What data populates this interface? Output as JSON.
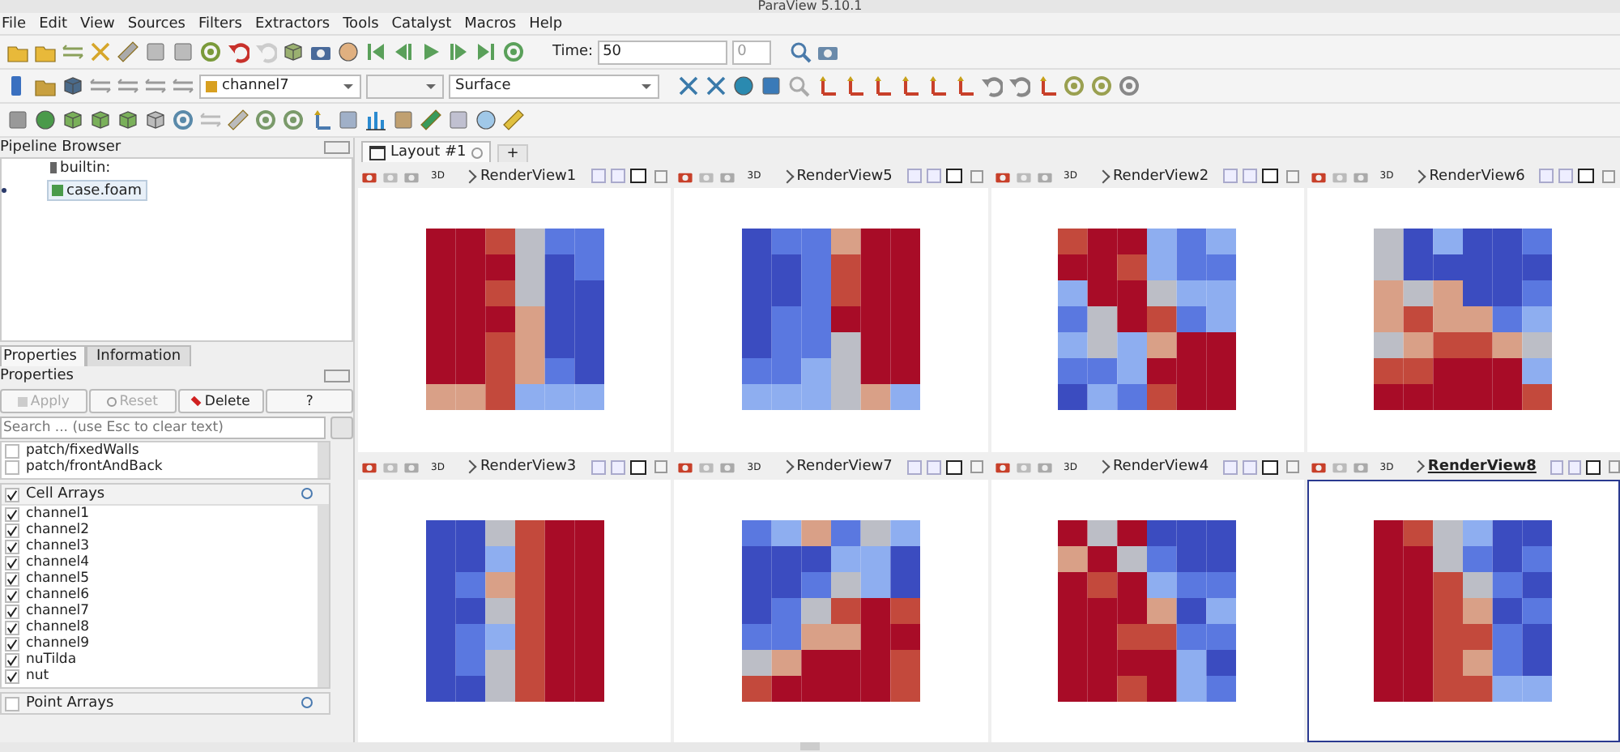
{
  "window": {
    "title": "ParaView 5.10.1"
  },
  "menu": [
    "File",
    "Edit",
    "View",
    "Sources",
    "Filters",
    "Extractors",
    "Tools",
    "Catalyst",
    "Macros",
    "Help"
  ],
  "toolbar": {
    "time_label": "Time:",
    "time_value": "50",
    "time_index": "0",
    "active_array": "channel7",
    "representation": "Surface"
  },
  "pipeline_browser": {
    "title": "Pipeline Browser",
    "items": [
      {
        "label": "builtin:",
        "selected": false,
        "children": [
          {
            "label": "case.foam",
            "selected": true,
            "visible": true
          }
        ]
      }
    ]
  },
  "panel_tabs": [
    {
      "label": "Properties",
      "selected": true
    },
    {
      "label": "Information",
      "selected": false
    }
  ],
  "properties": {
    "title": "Properties",
    "buttons": [
      {
        "label": "Apply",
        "kind": "apply",
        "disabled": true
      },
      {
        "label": "Reset",
        "kind": "reset",
        "disabled": true
      },
      {
        "label": "Delete",
        "kind": "delete",
        "disabled": false
      },
      {
        "label": "?",
        "kind": "help",
        "disabled": false
      }
    ],
    "search": {
      "placeholder": "Search ... (use Esc to clear text)"
    },
    "patches": [
      {
        "label": "patch/fixedWalls",
        "checked": false
      },
      {
        "label": "patch/frontAndBack",
        "checked": false
      }
    ],
    "cell_arrays": {
      "label": "Cell Arrays",
      "checked": true,
      "items": [
        {
          "label": "channel1",
          "checked": true
        },
        {
          "label": "channel2",
          "checked": true
        },
        {
          "label": "channel3",
          "checked": true
        },
        {
          "label": "channel4",
          "checked": true
        },
        {
          "label": "channel5",
          "checked": true
        },
        {
          "label": "channel6",
          "checked": true
        },
        {
          "label": "channel7",
          "checked": true
        },
        {
          "label": "channel8",
          "checked": true
        },
        {
          "label": "channel9",
          "checked": true
        },
        {
          "label": "nuTilda",
          "checked": true
        },
        {
          "label": "nut",
          "checked": true
        }
      ]
    },
    "point_arrays": {
      "label": "Point Arrays",
      "checked": false
    }
  },
  "layout_tabs": [
    {
      "label": "Layout #1",
      "selected": true
    }
  ],
  "add_tab": "+",
  "views": [
    {
      "title": "RenderView1",
      "mode": "3D",
      "active": false
    },
    {
      "title": "RenderView5",
      "mode": "3D",
      "active": false
    },
    {
      "title": "RenderView2",
      "mode": "3D",
      "active": false
    },
    {
      "title": "RenderView6",
      "mode": "3D",
      "active": false
    },
    {
      "title": "RenderView3",
      "mode": "3D",
      "active": false
    },
    {
      "title": "RenderView7",
      "mode": "3D",
      "active": false
    },
    {
      "title": "RenderView4",
      "mode": "3D",
      "active": false
    },
    {
      "title": "RenderView8",
      "mode": "3D",
      "active": true
    }
  ]
}
